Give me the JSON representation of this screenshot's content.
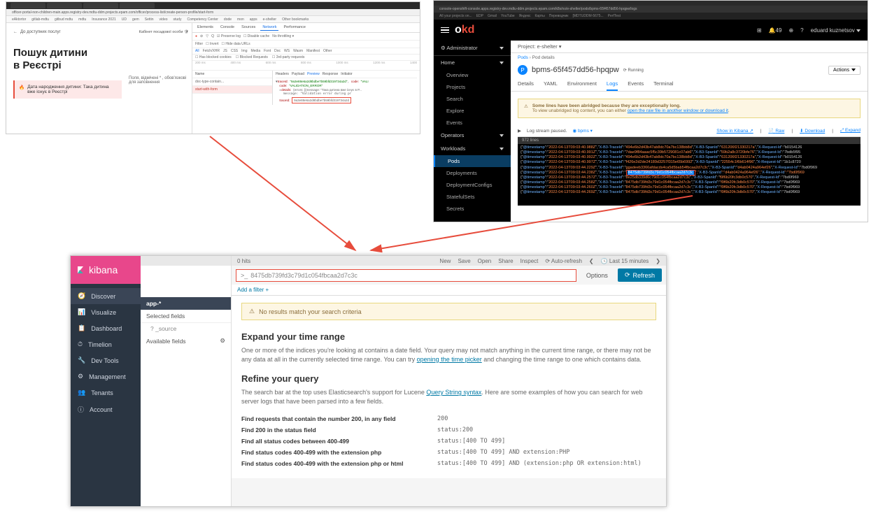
{
  "p1": {
    "url": "officer-portal-non-children-main.apps.registry-dev.mdtu-ddm.projects.epam.com/officer/process-list/create-person-profile/start-form",
    "bookmarks": [
      "eAktortor",
      "gitlab-mdtu",
      "gitbud mdtu",
      "mdtu",
      "Insurance 2021",
      "UD",
      "gem",
      "Settin",
      "video",
      "study",
      "Competency Center",
      "dode",
      "mon",
      "apps",
      "e-shelter",
      "Other bookmarks"
    ],
    "back": "До доступних послуг",
    "user": "Кабінет посадової особи",
    "title1": "Пошук дитини",
    "title2": "в Реєстрі",
    "error": "Дата народження дитини: Така дитина вже існує в Реєстрі",
    "hint": "Поля, відмічені * , обов'язкові для заповнення",
    "devtabs": [
      "Elements",
      "Console",
      "Sources",
      "Network",
      "Performance"
    ],
    "devtab_active": "Network",
    "filter_label": "Filter",
    "filter_opts": [
      "Invert",
      "Hide data URLs"
    ],
    "types": [
      "All",
      "Fetch/XHR",
      "JS",
      "CSS",
      "Img",
      "Media",
      "Font",
      "Doc",
      "WS",
      "Wasm",
      "Manifest",
      "Other"
    ],
    "cookies": [
      "Has blocked cookies",
      "Blocked Requests",
      "3rd-party requests"
    ],
    "timeline": [
      "200 ms",
      "400 ms",
      "600 ms",
      "800 ms",
      "1000 ms",
      "1200 ms",
      "1400"
    ],
    "name_hdr": "Name",
    "reqs": [
      "doc-type-contain...",
      "start-with-form"
    ],
    "reqtabs": [
      "Headers",
      "Payload",
      "Preview",
      "Response",
      "Initiator"
    ],
    "reqtab_active": "Preview",
    "resp_traceId_k": "traceId:",
    "resp_traceId_v": "\"9a3e88e6a2d8bdbe7b59bfd319734a2d\"",
    "resp_code_k": "code:",
    "resp_code_v": "\"VALIDATION_ERROR\"",
    "resp_details_k": "details:",
    "resp_details_v": "{errors: [{message: \"Така дитина вже існує в Р...",
    "resp_msg_k": "traceId:",
    "resp_msg_v": "9a3e88e6a2d8bdbe7b59bfd319734a2d"
  },
  "p2": {
    "url": "console-openshift-console.apps.registry-dev.mdtu-ddm.projects.epam.com/k8s/ns/e-shelter/pods/bpms-65f457dd56-hpqpw/logs",
    "bookmarks": [
      "All your projects on...",
      "EDP",
      "Gmail",
      "YouTube",
      "Яндекс",
      "Карты",
      "Переводчик",
      "[MDTUDDM-5675...",
      "PerfTest"
    ],
    "logo": {
      "o": "o",
      "kd": "kd"
    },
    "bell_count": "49",
    "user": "eduard kuznetsov",
    "admin": "Administrator",
    "sections": [
      {
        "label": "Home",
        "items": [
          "Overview",
          "Projects",
          "Search",
          "Explore",
          "Events"
        ]
      },
      {
        "label": "Operators",
        "items": []
      },
      {
        "label": "Workloads",
        "items": [
          "Pods",
          "Deployments",
          "DeploymentConfigs",
          "StatefulSets",
          "Secrets"
        ]
      }
    ],
    "active_item": "Pods",
    "project_label": "Project:",
    "project": "e-shelter",
    "crumb": [
      "Pods",
      "Pod details"
    ],
    "pod_icon": "P",
    "pod_name": "bpms-65f457dd56-hpqpw",
    "running": "Running",
    "actions": "Actions",
    "tabs": [
      "Details",
      "YAML",
      "Environment",
      "Logs",
      "Events",
      "Terminal"
    ],
    "tab_active": "Logs",
    "warn_title": "Some lines have been abridged because they are exceptionally long.",
    "warn_text": "To view unabridged log content, you can either ",
    "warn_link": "open the raw file in another window or download it",
    "logbar_paused": "Log stream paused.",
    "logbar_select": "bpms",
    "logbar_links": [
      "Show in Kibana",
      "Raw",
      "Download",
      "Expand"
    ],
    "lines": "972 lines",
    "trace_highlight": "8475db739fd3c79d1c054fbcaa2d7c3c",
    "logs": [
      "{\"@timestamp\":\"2022-04-13T09:03:40.988Z\",\"X-B3-TraceId\":\"494e6b2d43b47ab8dc70a7bc138bb8d\",\"X-B3-SpanId\":\"631206f21330217a\",\"X-Request-Id\":\"b0154126",
      "{\"@timestamp\":\"2022-04-13T09:03:40.991Z\",\"X-B3-TraceId\":\"7dae9f84aaac5f5c39b5729081c07ab6\",\"X-B3-SpanId\":\"59b2a8c3720bfe76\",\"X-Request-Id\":\"7bdb5f95",
      "{\"@timestamp\":\"2022-04-13T09:03:40.992Z\",\"X-B3-TraceId\":\"494e6b2d43b47ab8dc70a7bc138bb8d\",\"X-B3-SpanId\":\"631206f21330217a\",\"X-Request-Id\":\"b0154126",
      "{\"@timestamp\":\"2022-04-13T09:03:40.997Z\",\"X-B3-TraceId\":\"f426e2d2de24189d3257f315e65b6992\",\"X-B3-SpanId\":\"22554c1f6b614f96\",\"X-Request-Id\":\"1b1c8720",
      "{\"@timestamp\":\"2022-04-13T09:03:44.229Z\",\"X-B3-TraceId\":\"ggadeeb3366afdacds4ca5d5bab54fbcaa2d7c3c\",\"X-B3-SpanId\":\"d4ab0424a964ef26\",\"X-Request-Id\":\"7bd0f969",
      "{\"@timestamp\":\"2022-04-13T09:03:44.238Z\",\"X-B3-TraceId\":\"8475db739fd3c79d1c054fbcaa2d7c3c\",\"X-B3-SpanId\":\"d4ab0424a964ef26\",\"X-Request-Id\":\"7bd0f969",
      "{\"@timestamp\":\"2022-04-13T09:03:44.257Z\",\"X-B3-TraceId\":\"8e25db339d6c79d1c054fbcaa2d7c3c\",\"X-B3-SpanId\":\"f9f6b20fc3db0c570\",\"X-Request-Id\":\"7bd0f969",
      "{\"@timestamp\":\"2022-04-13T09:03:44.258Z\",\"X-B3-TraceId\":\"8475db739fd3c79d1c054fbcaa2d7c3c\",\"X-B3-SpanId\":\"f9f6b20fc3db0c570\",\"X-Request-Id\":\"7bd0f969",
      "{\"@timestamp\":\"2022-04-13T09:03:44.260Z\",\"X-B3-TraceId\":\"8475db739fd3c79d1c054fbcaa2d7c3c\",\"X-B3-SpanId\":\"f9f6b20fc3db0c570\",\"X-Request-Id\":\"7bd0f969",
      "{\"@timestamp\":\"2022-04-13T09:03:44.269Z\",\"X-B3-TraceId\":\"8475db739fd3c79d1c054fbcaa2d7c3c\",\"X-B3-SpanId\":\"f9f6b20fc3db0c570\",\"X-Request-Id\":\"7bd0f969"
    ]
  },
  "p3": {
    "logo": "kibana",
    "nav": [
      "Discover",
      "Visualize",
      "Dashboard",
      "Timelion",
      "Dev Tools",
      "Management",
      "Tenants",
      "Account"
    ],
    "nav_active": "Discover",
    "hits": "0 hits",
    "topmenu": [
      "New",
      "Save",
      "Open",
      "Share",
      "Inspect",
      "Auto-refresh"
    ],
    "timerange": "Last 15 minutes",
    "search_value": "8475db739fd3c79d1c054fbcaa2d7c3c",
    "options": "Options",
    "refresh": "Refresh",
    "add_filter": "Add a filter +",
    "index": "app-*",
    "selected_fields": "Selected fields",
    "source": "_source",
    "available_fields": "Available fields",
    "no_results": "No results match your search criteria",
    "expand_h": "Expand your time range",
    "expand_p1": "One or more of the indices you're looking at contains a date field. Your query may not match anything in the current time range, or there may not be any data at all in the currently selected time range. You can try ",
    "expand_link": "opening the time picker",
    "expand_p2": " and changing the time range to one which contains data.",
    "refine_h": "Refine your query",
    "refine_p1": "The search bar at the top uses Elasticsearch's support for Lucene ",
    "refine_link": "Query String syntax",
    "refine_p2": ". Here are some examples of how you can search for web server logs that have been parsed into a few fields.",
    "examples": [
      {
        "label": "Find requests that contain the number 200, in any field",
        "code": "200"
      },
      {
        "label": "Find 200 in the status field",
        "code": "status:200"
      },
      {
        "label": "Find all status codes between 400-499",
        "code": "status:[400 TO 499]"
      },
      {
        "label": "Find status codes 400-499 with the extension php",
        "code": "status:[400 TO 499] AND extension:PHP"
      },
      {
        "label": "Find status codes 400-499 with the extension php or html",
        "code": "status:[400 TO 499] AND (extension:php OR extension:html)"
      }
    ]
  }
}
